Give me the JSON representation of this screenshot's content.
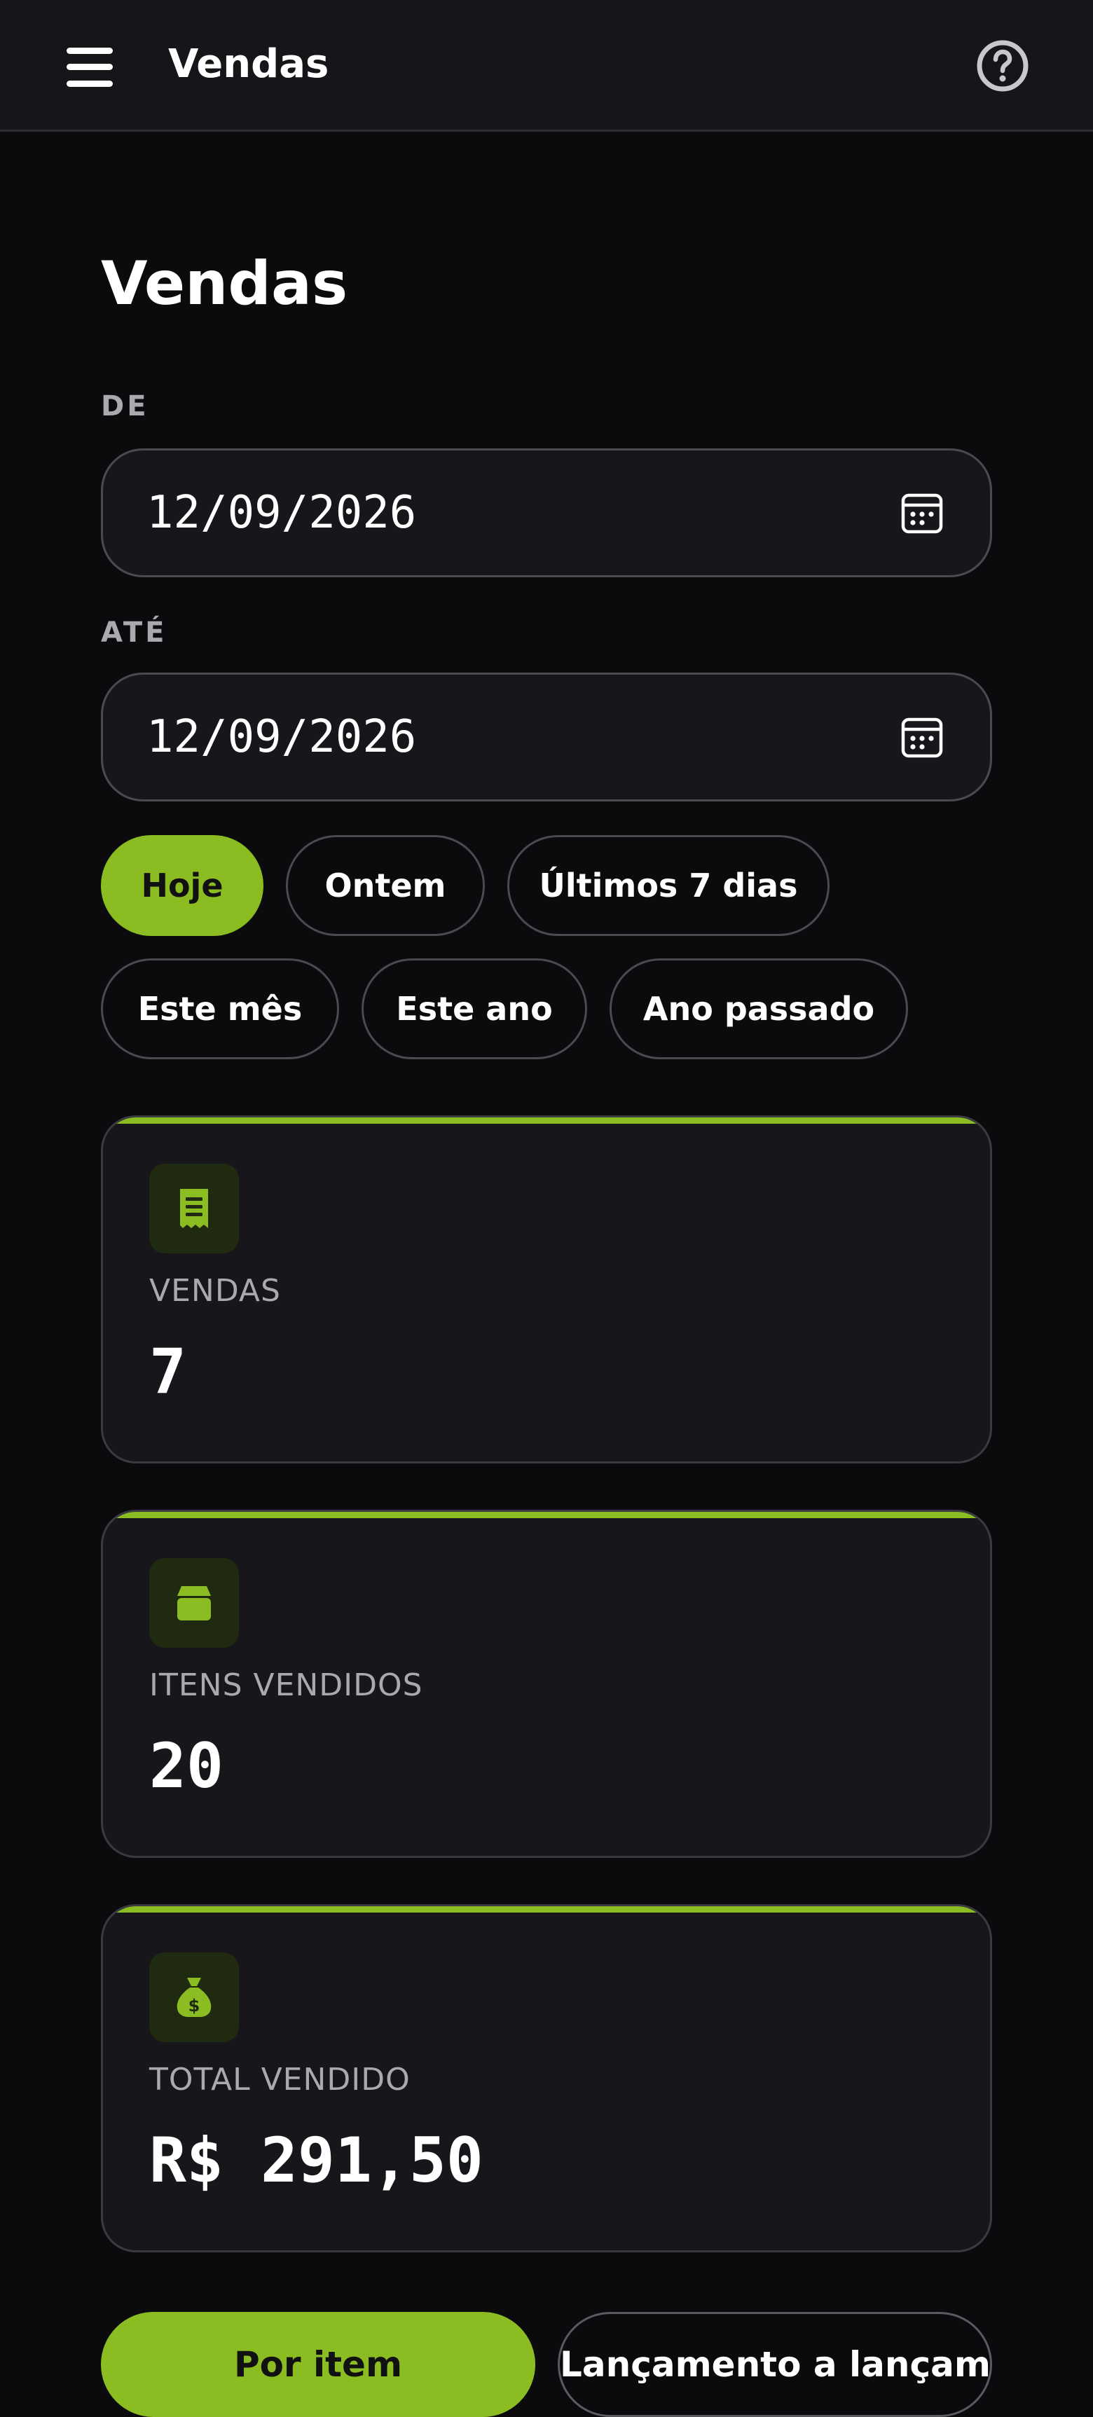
{
  "topbar": {
    "title": "Vendas",
    "menu_icon": "hamburger-menu-icon",
    "help_icon": "help-circle-icon"
  },
  "page": {
    "title": "Vendas"
  },
  "filters": {
    "from_label": "DE",
    "from_value": "12/09/2026",
    "to_label": "ATÉ",
    "to_value": "12/09/2026",
    "calendar_icon": "calendar-icon"
  },
  "quick_ranges": [
    {
      "label": "Hoje",
      "active": true
    },
    {
      "label": "Ontem",
      "active": false
    },
    {
      "label": "Últimos 7 dias",
      "active": false
    },
    {
      "label": "Este mês",
      "active": false
    },
    {
      "label": "Este ano",
      "active": false
    },
    {
      "label": "Ano passado",
      "active": false
    }
  ],
  "stats": [
    {
      "label": "VENDAS",
      "value": "7",
      "icon": "receipt-icon"
    },
    {
      "label": "ITENS VENDIDOS",
      "value": "20",
      "icon": "box-icon"
    },
    {
      "label": "TOTAL VENDIDO",
      "value": "R$ 291,50",
      "icon": "money-bag-icon"
    }
  ],
  "views": {
    "primary_label": "Por item",
    "secondary_label": "Lançamento a lançamento"
  },
  "colors": {
    "accent": "#8bbd22",
    "background": "#0b0b0d",
    "surface": "#17171b",
    "border": "#4a4a50",
    "muted_text": "#a9a9ae"
  }
}
